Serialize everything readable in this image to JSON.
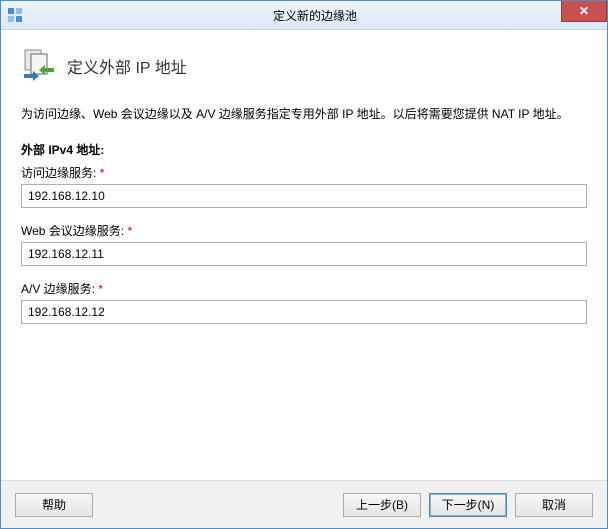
{
  "window": {
    "title": "定义新的边缘池"
  },
  "header": {
    "title": "定义外部 IP 地址"
  },
  "description": "为访问边缘、Web 会议边缘以及 A/V 边缘服务指定专用外部 IP 地址。以后将需要您提供 NAT IP 地址。",
  "section": {
    "heading": "外部 IPv4 地址:"
  },
  "fields": {
    "access": {
      "label": "访问边缘服务:",
      "required": "*",
      "value": "192.168.12.10"
    },
    "webconf": {
      "label": "Web 会议边缘服务:",
      "required": "*",
      "value": "192.168.12.11"
    },
    "av": {
      "label": "A/V 边缘服务:",
      "required": "*",
      "value": "192.168.12.12"
    }
  },
  "buttons": {
    "help": "帮助",
    "back": "上一步(B)",
    "next": "下一步(N)",
    "cancel": "取消"
  },
  "icons": {
    "app": "topology-app-icon",
    "header": "server-arrows-icon",
    "close": "✕"
  }
}
